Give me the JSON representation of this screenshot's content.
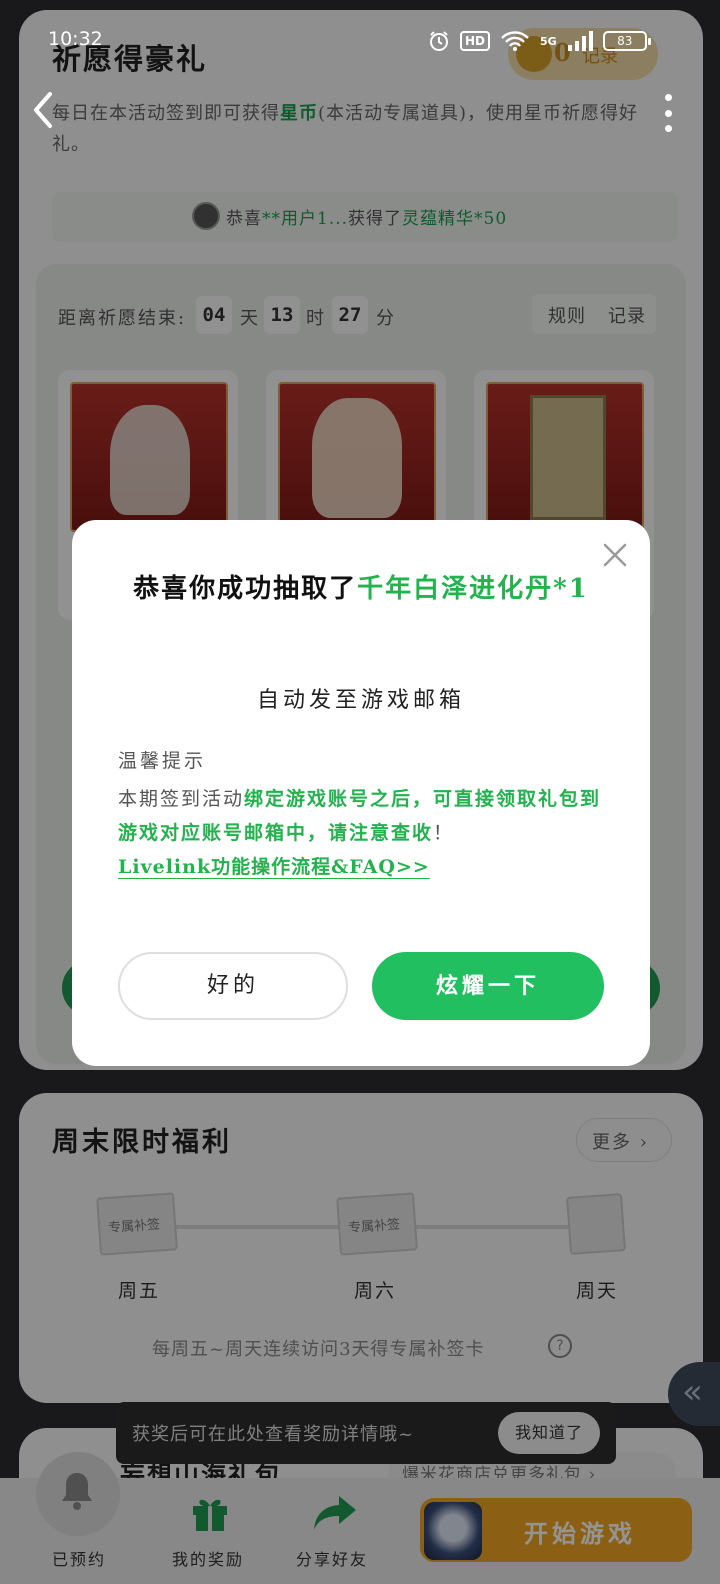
{
  "status_bar": {
    "time": "10:32",
    "hd": "HD",
    "net": "5G",
    "battery": "83"
  },
  "wish_card": {
    "title": "祈愿得豪礼",
    "coin_count": "0",
    "record_link": "记录",
    "desc_1": "每日在本活动签到即可获得",
    "desc_highlight": "星币",
    "desc_2": "(本活动专属道具)，使用星币祈愿得好礼。",
    "ticker_prefix": "恭喜",
    "ticker_user": "**用户1...",
    "ticker_mid": "获得了",
    "ticker_prize": "灵蕴精华*50",
    "countdown_label": "距离祈愿结束:",
    "days": "04",
    "days_unit": "天",
    "hours": "13",
    "hours_unit": "时",
    "minutes": "27",
    "minutes_unit": "分",
    "rule_label": "规则",
    "record_label": "记录"
  },
  "weekend_card": {
    "title": "周末限时福利",
    "more_label": "更多",
    "card_text": "专属补签",
    "days": [
      "周五",
      "周六",
      "周天"
    ],
    "tip": "每周五~周天连续访问3天得专属补签卡",
    "help": "?"
  },
  "gift_card": {
    "title": "妄想山海礼包",
    "link": "爆米花商店兑更多礼包"
  },
  "toast": {
    "text": "获奖后可在此处查看奖励详情哦~",
    "button": "我知道了"
  },
  "bottom_bar": {
    "tab_reserved": "已预约",
    "tab_rewards": "我的奖励",
    "tab_share": "分享好友",
    "start": "开始游戏"
  },
  "dialog": {
    "title_prefix": "恭喜你成功抽取了",
    "prize": "千年白泽进化丹*1",
    "subtitle": "自动发至游戏邮箱",
    "tip_heading": "温馨提示",
    "tip_plain": "本期签到活动",
    "tip_green": "绑定游戏账号之后，可直接领取礼包到游戏对应账号邮箱中，请注意查收",
    "tip_end": "！",
    "link": "Livelink功能操作流程&FAQ>>",
    "ok_button": "好的",
    "show_button": "炫耀一下"
  },
  "colors": {
    "accent_green": "#22bf60",
    "start_orange": "#f2a623"
  }
}
